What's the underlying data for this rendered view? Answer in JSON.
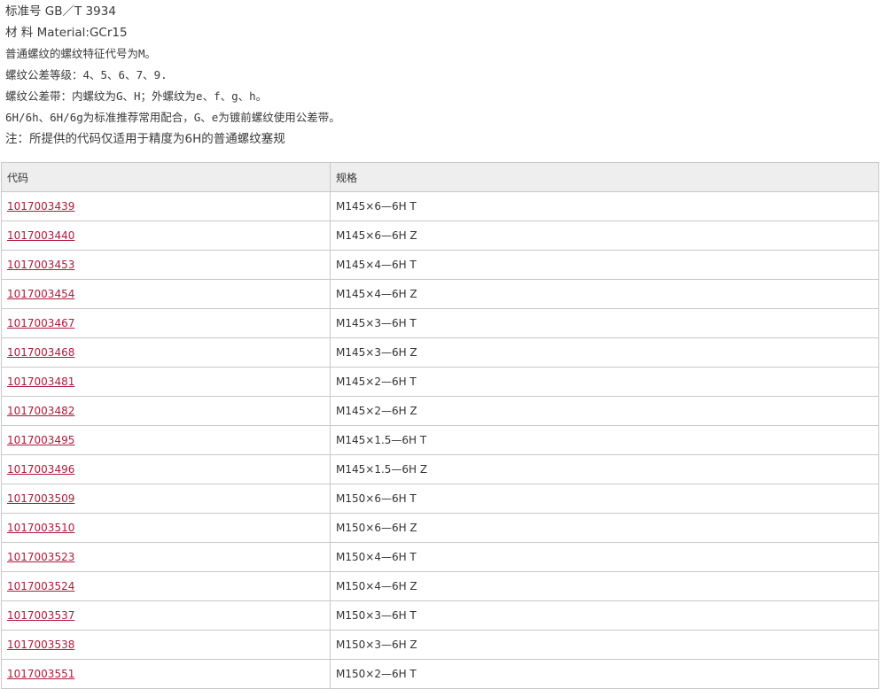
{
  "notes": [
    "标准号 GB／T 3934",
    "材 料 Material:GCr15",
    "普通螺纹的螺纹特征代号为M。",
    "螺纹公差等级：4、5、6、7、9.",
    "螺纹公差带：内螺纹为G、H；外螺纹为e、f、g、h。",
    "6H/6h、6H/6g为标准推荐常用配合，G、e为镀前螺纹使用公差带。",
    "注：所提供的代码仅适用于精度为6H的普通螺纹塞规"
  ],
  "table": {
    "headers": [
      "代码",
      "规格"
    ],
    "rows": [
      [
        "1017003439",
        "M145×6—6H T"
      ],
      [
        "1017003440",
        "M145×6—6H Z"
      ],
      [
        "1017003453",
        "M145×4—6H T"
      ],
      [
        "1017003454",
        "M145×4—6H Z"
      ],
      [
        "1017003467",
        "M145×3—6H T"
      ],
      [
        "1017003468",
        "M145×3—6H Z"
      ],
      [
        "1017003481",
        "M145×2—6H T"
      ],
      [
        "1017003482",
        "M145×2—6H Z"
      ],
      [
        "1017003495",
        "M145×1.5—6H T"
      ],
      [
        "1017003496",
        "M145×1.5—6H Z"
      ],
      [
        "1017003509",
        "M150×6—6H T"
      ],
      [
        "1017003510",
        "M150×6—6H Z"
      ],
      [
        "1017003523",
        "M150×4—6H T"
      ],
      [
        "1017003524",
        "M150×4—6H Z"
      ],
      [
        "1017003537",
        "M150×3—6H T"
      ],
      [
        "1017003538",
        "M150×3—6H Z"
      ],
      [
        "1017003551",
        "M150×2—6H T"
      ]
    ]
  },
  "colors": {
    "link": "#b01a3c",
    "header_bg": "#eeeeee",
    "border": "#c8c8c8"
  }
}
